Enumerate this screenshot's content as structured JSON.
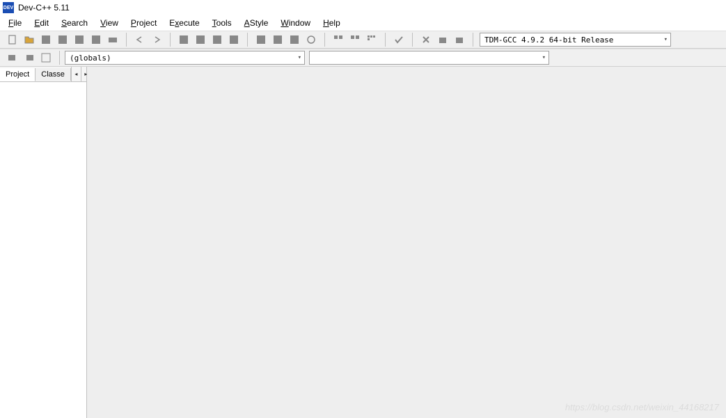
{
  "window": {
    "title": "Dev-C++ 5.11",
    "app_icon_text": "DEV"
  },
  "menubar": {
    "file": "File",
    "edit": "Edit",
    "search": "Search",
    "view": "View",
    "project": "Project",
    "execute": "Execute",
    "tools": "Tools",
    "astyle": "AStyle",
    "window": "Window",
    "help": "Help"
  },
  "toolbar": {
    "compiler_combo": "TDM-GCC 4.9.2 64-bit Release",
    "scope_combo": "(globals)",
    "member_combo": ""
  },
  "side_tabs": {
    "project": "Project",
    "classes": "Classe"
  },
  "watermark": "https://blog.csdn.net/weixin_44168217"
}
